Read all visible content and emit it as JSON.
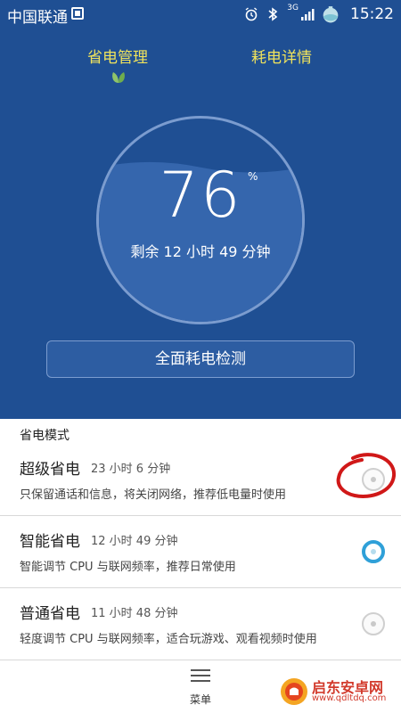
{
  "status_bar": {
    "carrier": "中国联通",
    "network": "3G",
    "time": "15:22",
    "icons": [
      "sim-icon",
      "alarm-icon",
      "bluetooth-icon",
      "signal-icon",
      "battery-icon"
    ]
  },
  "tabs": {
    "left": "省电管理",
    "right": "耗电详情"
  },
  "gauge": {
    "value": "76",
    "unit": "%",
    "level_percent": 76,
    "remaining": "剩余 12 小时 49 分钟"
  },
  "check_button": "全面耗电检测",
  "modes_section": {
    "title": "省电模式",
    "items": [
      {
        "name": "超级省电",
        "duration": "23 小时 6 分钟",
        "desc": "只保留通话和信息，将关闭网络，推荐低电量时使用",
        "selected": false
      },
      {
        "name": "智能省电",
        "duration": "12 小时 49 分钟",
        "desc": "智能调节 CPU 与联网频率，推荐日常使用",
        "selected": true
      },
      {
        "name": "普通省电",
        "duration": "11 小时 48 分钟",
        "desc": "轻度调节 CPU 与联网频率，适合玩游戏、观看视频时使用",
        "selected": false
      }
    ]
  },
  "menu": {
    "label": "菜单",
    "icon": "menu-icon"
  },
  "watermark": {
    "title": "启东安卓网",
    "url": "www.qdltdq.com"
  },
  "colors": {
    "top_bg": "#1f4f93",
    "tab_text": "#f0e35c",
    "radio_selected": "#2fa0d8",
    "annotation_red": "#d01818"
  }
}
